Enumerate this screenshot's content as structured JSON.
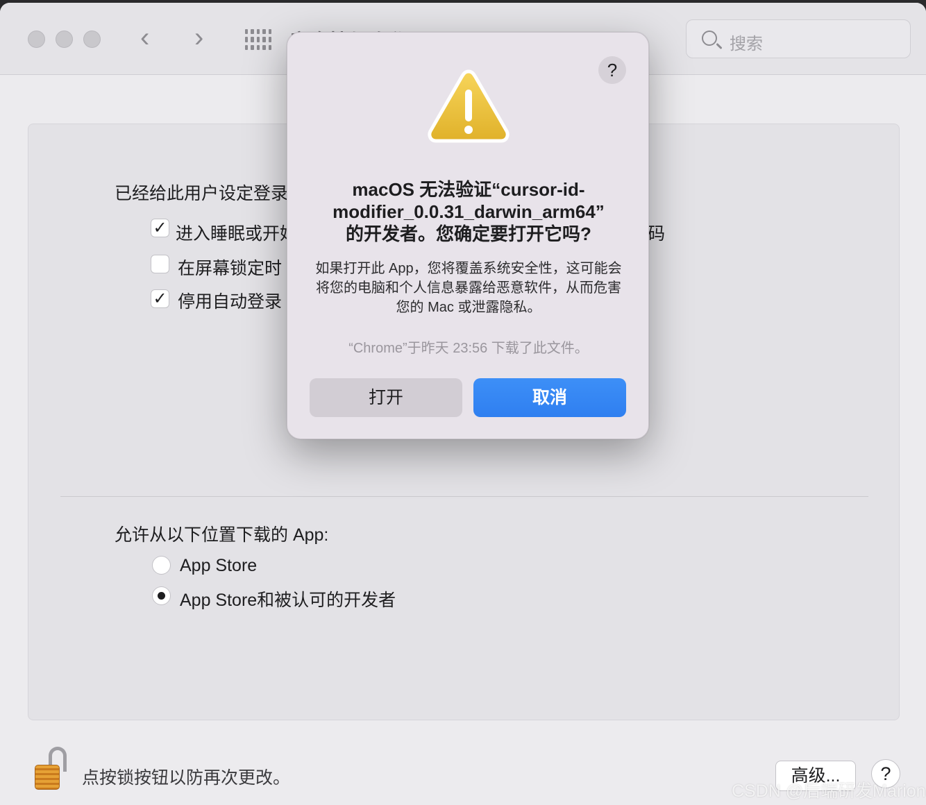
{
  "window": {
    "title": "安全性与隐私",
    "search_placeholder": "搜索"
  },
  "general": {
    "heading": "已经给此用户设定登录",
    "options": [
      {
        "label": "进入睡眠或开始",
        "checked": true
      },
      {
        "label": "在屏幕锁定时",
        "checked": false
      },
      {
        "label": "停用自动登录",
        "checked": true
      }
    ],
    "trailing_char": "码"
  },
  "downloads": {
    "heading": "允许从以下位置下载的 App:",
    "options": [
      {
        "label": "App Store",
        "selected": false
      },
      {
        "label": "App Store和被认可的开发者",
        "selected": true
      }
    ]
  },
  "footer": {
    "lock_text": "点按锁按钮以防再次更改。",
    "advanced_label": "高级...",
    "help_label": "?"
  },
  "dialog": {
    "help_label": "?",
    "title_line1": "macOS 无法验证“cursor-id-",
    "title_line2": "modifier_0.0.31_darwin_arm64”",
    "title_line3": "的开发者。您确定要打开它吗?",
    "body": "如果打开此 App，您将覆盖系统安全性，这可能会将您的电脑和个人信息暴露给恶意软件，从而危害您的 Mac 或泄露隐私。",
    "note": "“Chrome”于昨天 23:56 下载了此文件。",
    "open_label": "打开",
    "cancel_label": "取消"
  },
  "watermark": "CSDN @后端研发Marion",
  "colors": {
    "accent": "#2f7ff0",
    "warning": "#f2c037"
  }
}
